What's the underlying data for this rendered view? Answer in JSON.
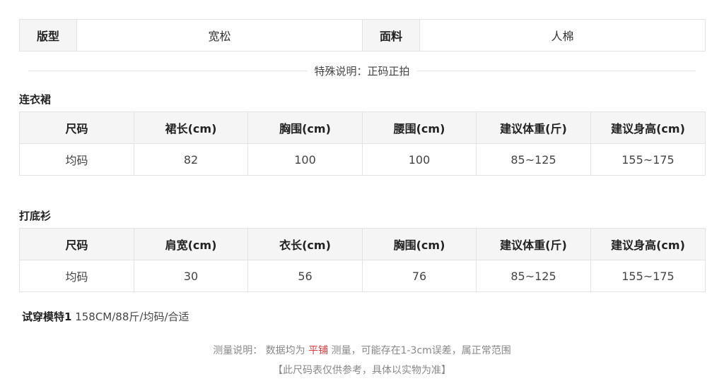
{
  "summary": {
    "fit_label": "版型",
    "fit_value": "宽松",
    "fabric_label": "面料",
    "fabric_value": "人棉"
  },
  "note": "特殊说明：正码正拍",
  "dress": {
    "title": "连衣裙",
    "headers": [
      "尺码",
      "裙长(cm)",
      "胸围(cm)",
      "腰围(cm)",
      "建议体重(斤)",
      "建议身高(cm)"
    ],
    "row": [
      "均码",
      "82",
      "100",
      "100",
      "85~125",
      "155~175"
    ]
  },
  "undershirt": {
    "title": "打底衫",
    "headers": [
      "尺码",
      "肩宽(cm)",
      "衣长(cm)",
      "胸围(cm)",
      "建议体重(斤)",
      "建议身高(cm)"
    ],
    "row": [
      "均码",
      "30",
      "56",
      "76",
      "85~125",
      "155~175"
    ]
  },
  "model": {
    "label": "试穿模特1",
    "value": " 158CM/88斤/均码/合适"
  },
  "footer": {
    "prefix": "测量说明： 数据均为 ",
    "highlight": "平铺",
    "suffix": " 测量，可能存在1-3cm误差，属正常范围",
    "disclaimer": "【此尺码表仅供参考，具体以实物为准】"
  },
  "colors": {
    "highlight": "#e23a3a",
    "header_bg": "#f5f5f5",
    "border": "#e3e3e3"
  }
}
